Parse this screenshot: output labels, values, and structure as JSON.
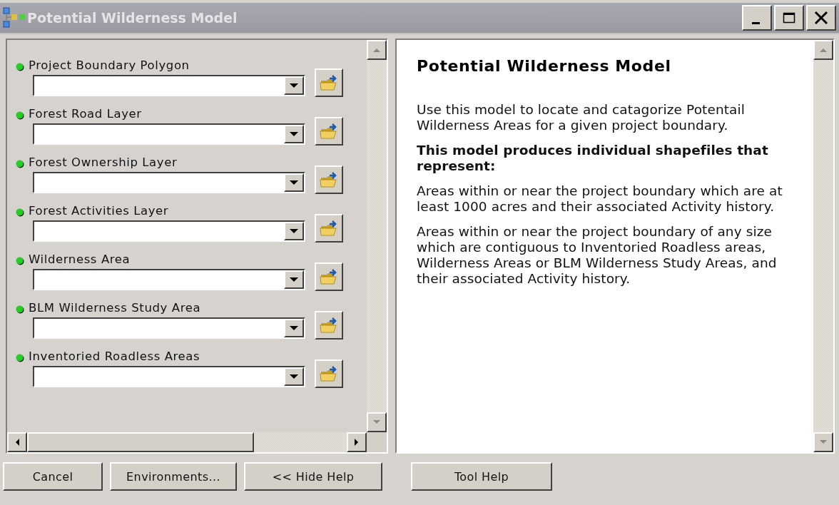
{
  "window": {
    "title": "Potential Wilderness Model"
  },
  "parameters": [
    {
      "label": "Project Boundary Polygon"
    },
    {
      "label": "Forest Road Layer"
    },
    {
      "label": "Forest Ownership Layer"
    },
    {
      "label": "Forest Activities Layer"
    },
    {
      "label": "Wilderness Area"
    },
    {
      "label": "BLM Wilderness Study Area"
    },
    {
      "label": "Inventoried Roadless Areas"
    }
  ],
  "help": {
    "title": "Potential Wilderness Model",
    "paragraphs": [
      {
        "kind": "plain",
        "text": "Use this model to locate and catagorize Potentail Wilderness Areas for a given project boundary."
      },
      {
        "kind": "bold",
        "text": "This model produces individual shapefiles that represent:"
      },
      {
        "kind": "plain",
        "text": "Areas within or near the project boundary which are at least 1000 acres and their associated Activity history."
      },
      {
        "kind": "plain",
        "text": "Areas within or near the project boundary of any size which are contiguous to Inventoried Roadless areas, Wilderness Areas or BLM Wilderness Study Areas, and their associated Activity history."
      }
    ]
  },
  "buttons": [
    {
      "label": "Cancel"
    },
    {
      "label": "Environments..."
    },
    {
      "label": "<< Hide Help"
    }
  ],
  "help_button": {
    "label": "Tool Help"
  }
}
